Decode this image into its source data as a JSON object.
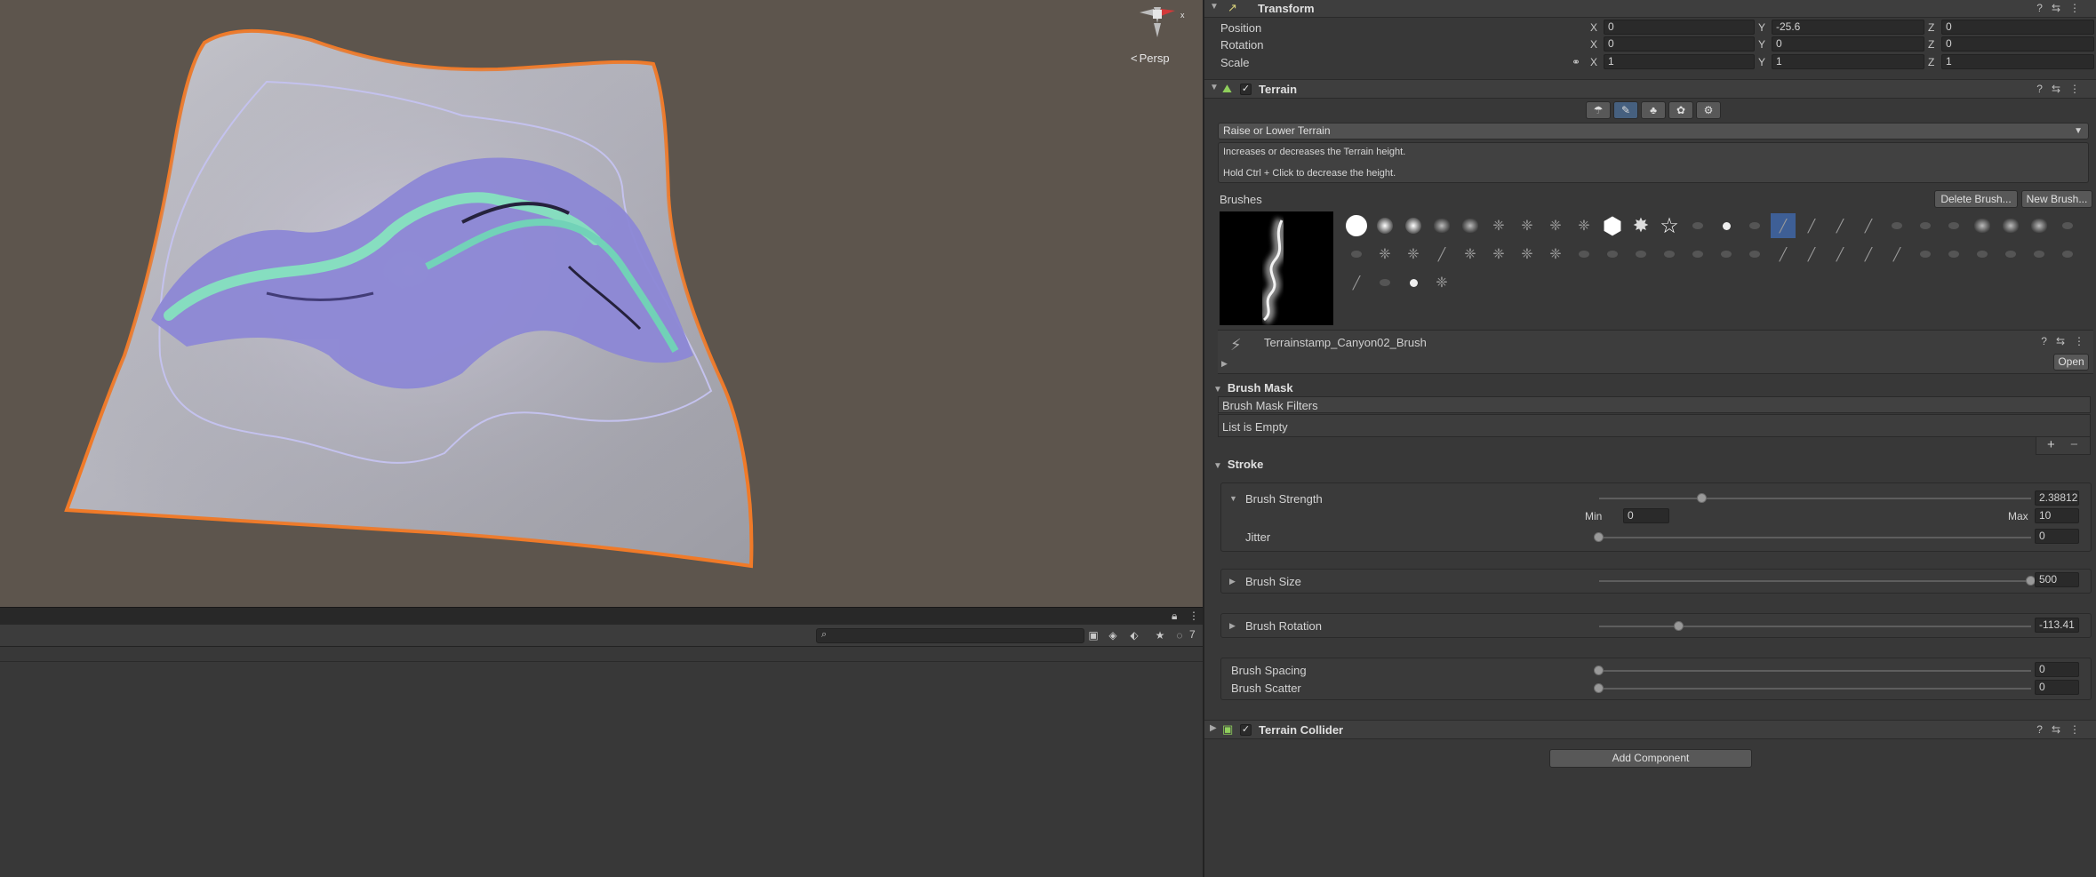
{
  "scene": {
    "persp_label": "Persp",
    "gizmo_axis_x": "x",
    "colors": {
      "background": "#5d554d",
      "selection_outline": "#f07a28",
      "terrain": "#b9b9c2",
      "canyon": "#8a86d8",
      "canyon_highlight": "#84e0c0"
    }
  },
  "bottom_panel": {
    "lock_icon": "lock-icon",
    "menu_icon": "vertical-dots-icon",
    "search_placeholder": "",
    "hidden_count": "7"
  },
  "inspector": {
    "transform": {
      "title": "Transform",
      "position": {
        "label": "Position",
        "x_label": "X",
        "x": "0",
        "y_label": "Y",
        "y": "-25.6",
        "z_label": "Z",
        "z": "0"
      },
      "rotation": {
        "label": "Rotation",
        "x_label": "X",
        "x": "0",
        "y_label": "Y",
        "y": "0",
        "z_label": "Z",
        "z": "0"
      },
      "scale": {
        "label": "Scale",
        "x_label": "X",
        "x": "1",
        "y_label": "Y",
        "y": "1",
        "z_label": "Z",
        "z": "1"
      }
    },
    "terrain": {
      "title": "Terrain",
      "enabled": true,
      "tools": [
        "raise-terrain-tool-icon",
        "paint-terrain-tool-icon",
        "paint-trees-tool-icon",
        "paint-details-tool-icon",
        "terrain-settings-tool-icon"
      ],
      "active_tool_index": 1,
      "mode_dropdown": "Raise or Lower Terrain",
      "help_line_1": "Increases or decreases the Terrain height.",
      "help_line_2": "Hold Ctrl + Click to decrease the height.",
      "brushes_label": "Brushes",
      "delete_brush": "Delete Brush...",
      "new_brush": "New Brush...",
      "brush_name": "Terrainstamp_Canyon02_Brush",
      "open_button": "Open",
      "brush_mask": {
        "title": "Brush Mask",
        "filters_label": "Brush Mask Filters",
        "empty_text": "List is Empty",
        "add": "+",
        "remove": "−"
      },
      "stroke": {
        "title": "Stroke",
        "brush_strength": {
          "label": "Brush Strength",
          "value": "2.38812",
          "fraction": 0.2388,
          "min_label": "Min",
          "min": "0",
          "max_label": "Max",
          "max": "10"
        },
        "jitter": {
          "label": "Jitter",
          "value": "0",
          "fraction": 0
        },
        "brush_size": {
          "label": "Brush Size",
          "value": "500",
          "fraction": 1.0
        },
        "brush_rotation": {
          "label": "Brush Rotation",
          "value": "-113.41",
          "fraction": 0.185
        },
        "brush_spacing": {
          "label": "Brush Spacing",
          "value": "0",
          "fraction": 0
        },
        "brush_scatter": {
          "label": "Brush Scatter",
          "value": "0",
          "fraction": 0
        }
      }
    },
    "terrain_collider": {
      "title": "Terrain Collider",
      "enabled": true
    },
    "add_component": "Add Component"
  }
}
